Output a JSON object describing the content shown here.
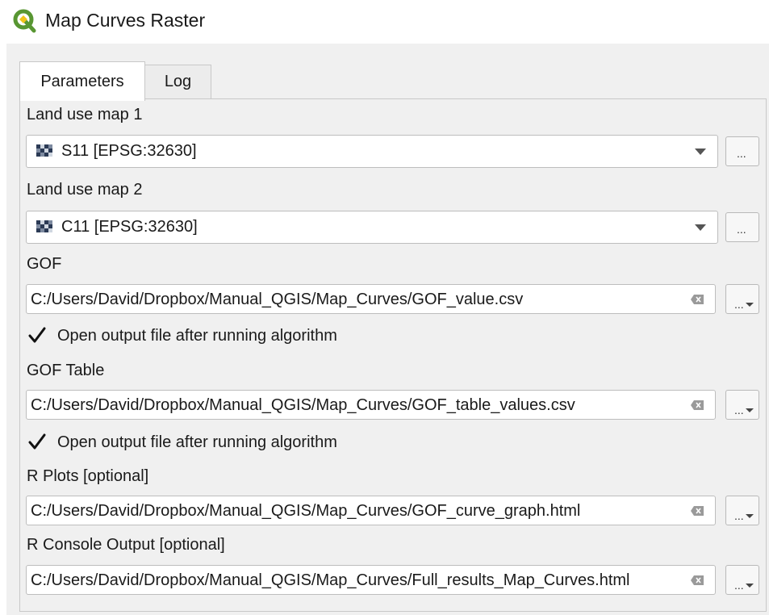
{
  "window": {
    "title": "Map Curves Raster"
  },
  "tabs": [
    {
      "label": "Parameters",
      "active": true
    },
    {
      "label": "Log",
      "active": false
    }
  ],
  "params": {
    "map1_label": "Land use map 1",
    "map1_value": "S11 [EPSG:32630]",
    "map2_label": "Land use map 2",
    "map2_value": "C11 [EPSG:32630]",
    "gof_label": "GOF",
    "gof_value": "C:/Users/David/Dropbox/Manual_QGIS/Map_Curves/GOF_value.csv",
    "gof_open_label": "Open output file after running algorithm",
    "gof_open_checked": true,
    "gof_table_label": "GOF Table",
    "gof_table_value": "C:/Users/David/Dropbox/Manual_QGIS/Map_Curves/GOF_table_values.csv",
    "gof_table_open_label": "Open output file after running algorithm",
    "gof_table_open_checked": true,
    "rplots_label": "R Plots [optional]",
    "rplots_value": "C:/Users/David/Dropbox/Manual_QGIS/Map_Curves/GOF_curve_graph.html",
    "rconsole_label": "R Console Output [optional]",
    "rconsole_value": "C:/Users/David/Dropbox/Manual_QGIS/Map_Curves/Full_results_Map_Curves.html",
    "browse_label": "..."
  },
  "icons": {
    "app": "qgis-logo-icon",
    "raster": "raster-layer-icon",
    "clear": "clear-field-icon",
    "check": "checkmark-icon",
    "dropdown": "chevron-down-icon"
  },
  "colors": {
    "qgis_green": "#589632",
    "qgis_yellow": "#f0c419"
  }
}
